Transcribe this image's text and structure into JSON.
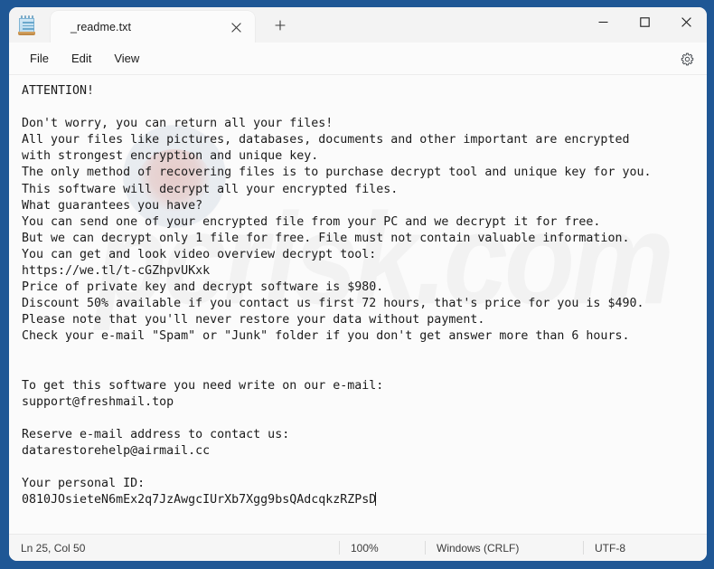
{
  "window": {
    "app_icon": "notepad-icon",
    "caption": {
      "minimize": "minimize-icon",
      "maximize": "maximize-icon",
      "close": "close-icon"
    }
  },
  "tabs": {
    "active": {
      "label": "_readme.txt",
      "close_label": "close-tab-icon"
    },
    "new_tab_label": "new-tab-icon"
  },
  "menubar": {
    "items": [
      {
        "label": "File"
      },
      {
        "label": "Edit"
      },
      {
        "label": "View"
      }
    ],
    "settings_label": "gear-icon"
  },
  "document": {
    "watermark": "pcrisk.com",
    "lines": [
      "ATTENTION!",
      "",
      "Don't worry, you can return all your files!",
      "All your files like pictures, databases, documents and other important are encrypted",
      "with strongest encryption and unique key.",
      "The only method of recovering files is to purchase decrypt tool and unique key for you.",
      "This software will decrypt all your encrypted files.",
      "What guarantees you have?",
      "You can send one of your encrypted file from your PC and we decrypt it for free.",
      "But we can decrypt only 1 file for free. File must not contain valuable information.",
      "You can get and look video overview decrypt tool:",
      "https://we.tl/t-cGZhpvUKxk",
      "Price of private key and decrypt software is $980.",
      "Discount 50% available if you contact us first 72 hours, that's price for you is $490.",
      "Please note that you'll never restore your data without payment.",
      "Check your e-mail \"Spam\" or \"Junk\" folder if you don't get answer more than 6 hours.",
      "",
      "",
      "To get this software you need write on our e-mail:",
      "support@freshmail.top",
      "",
      "Reserve e-mail address to contact us:",
      "datarestorehelp@airmail.cc",
      "",
      "Your personal ID:",
      "0810JOsieteN6mEx2q7JzAwgcIUrXb7Xgg9bsQAdcqkzRZPsD"
    ],
    "text": "ATTENTION!\n\nDon't worry, you can return all your files!\nAll your files like pictures, databases, documents and other important are encrypted\nwith strongest encryption and unique key.\nThe only method of recovering files is to purchase decrypt tool and unique key for you.\nThis software will decrypt all your encrypted files.\nWhat guarantees you have?\nYou can send one of your encrypted file from your PC and we decrypt it for free.\nBut we can decrypt only 1 file for free. File must not contain valuable information.\nYou can get and look video overview decrypt tool:\nhttps://we.tl/t-cGZhpvUKxk\nPrice of private key and decrypt software is $980.\nDiscount 50% available if you contact us first 72 hours, that's price for you is $490.\nPlease note that you'll never restore your data without payment.\nCheck your e-mail \"Spam\" or \"Junk\" folder if you don't get answer more than 6 hours.\n\n\nTo get this software you need write on our e-mail:\nsupport@freshmail.top\n\nReserve e-mail address to contact us:\ndatarestorehelp@airmail.cc\n\nYour personal ID:\n0810JOsieteN6mEx2q7JzAwgcIUrXb7Xgg9bsQAdcqkzRZPsD"
  },
  "statusbar": {
    "position": "Ln 25, Col 50",
    "zoom": "100%",
    "line_ending": "Windows (CRLF)",
    "encoding": "UTF-8"
  },
  "colors": {
    "desktop": "#1f5795",
    "window_bg": "#f3f3f3",
    "editor_bg": "#fbfbfb",
    "text": "#1b1b1b",
    "status_bg": "#f6f6f6"
  }
}
